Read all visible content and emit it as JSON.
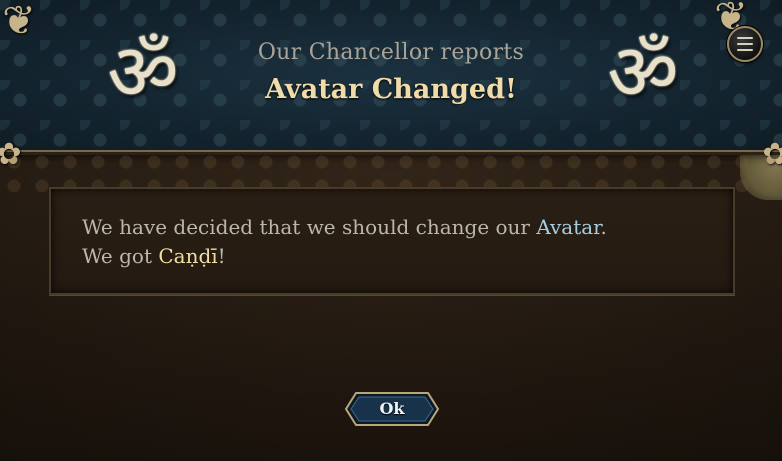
{
  "header": {
    "subtitle": "Our Chancellor reports",
    "title": "Avatar Changed!",
    "emblem_glyph": "ॐ",
    "emblem_icon": "om-icon",
    "menu_icon": "hamburger-menu-icon"
  },
  "message": {
    "line1_prefix": "We have decided that we should change our ",
    "line1_highlight": "Avatar",
    "line1_suffix": ".",
    "line2_prefix": "We got ",
    "line2_highlight": "Caṇḍī",
    "line2_suffix": "!"
  },
  "actions": {
    "ok_label": "Ok"
  },
  "colors": {
    "header_bg": "#13232c",
    "title": "#efdca8",
    "highlight_blue": "#a6cde0",
    "highlight_gold": "#f1dea4",
    "body_text": "#bdb6aa",
    "button_bg": "#17324a"
  }
}
